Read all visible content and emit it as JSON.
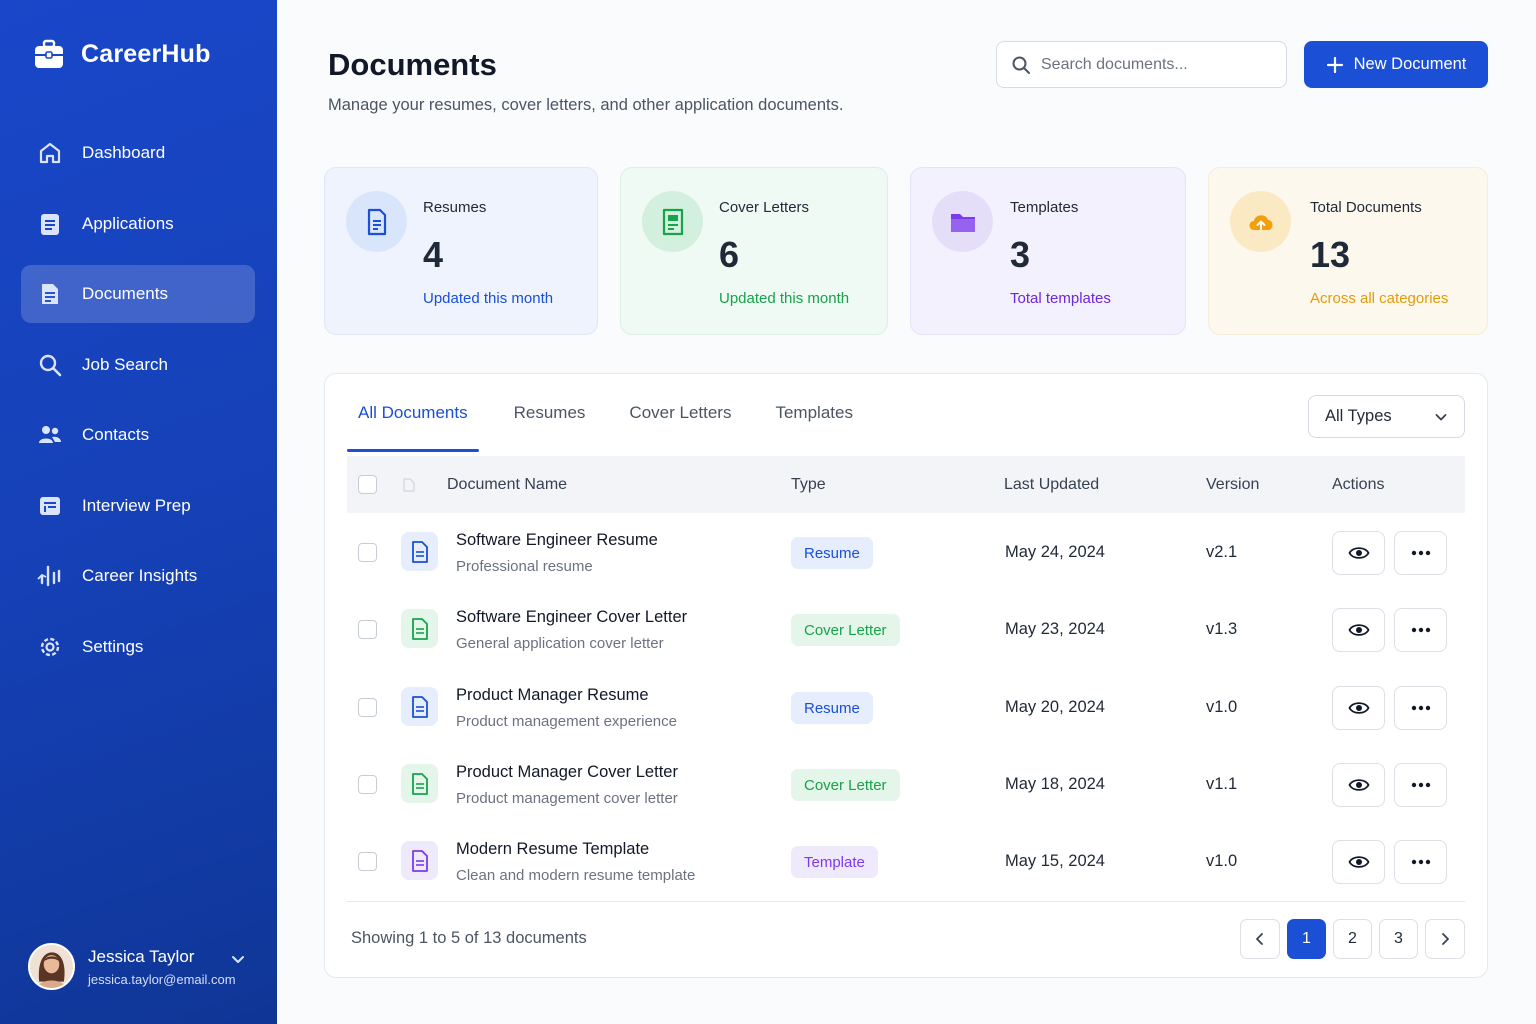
{
  "app": {
    "name": "CareerHub"
  },
  "sidebar": {
    "items": [
      {
        "label": "Dashboard",
        "icon": "home-icon"
      },
      {
        "label": "Applications",
        "icon": "clipboard-icon"
      },
      {
        "label": "Documents",
        "icon": "document-icon",
        "active": true
      },
      {
        "label": "Job Search",
        "icon": "search-icon"
      },
      {
        "label": "Contacts",
        "icon": "users-icon"
      },
      {
        "label": "Interview Prep",
        "icon": "calendar-board-icon"
      },
      {
        "label": "Career Insights",
        "icon": "insights-icon"
      },
      {
        "label": "Settings",
        "icon": "gear-icon"
      }
    ],
    "user": {
      "name": "Jessica Taylor",
      "email": "jessica.taylor@email.com"
    }
  },
  "header": {
    "title": "Documents",
    "subtitle": "Manage your resumes, cover letters, and other application documents.",
    "search_placeholder": "Search documents...",
    "new_button": "New Document"
  },
  "stats": [
    {
      "label": "Resumes",
      "value": "4",
      "note": "Updated this month",
      "color": "#1a4fd6"
    },
    {
      "label": "Cover Letters",
      "value": "6",
      "note": "Updated this month",
      "color": "#16a34a"
    },
    {
      "label": "Templates",
      "value": "3",
      "note": "Total templates",
      "color": "#7c3aed"
    },
    {
      "label": "Total Documents",
      "value": "13",
      "note": "Across all categories",
      "color": "#f59e0b"
    }
  ],
  "tabs": [
    "All Documents",
    "Resumes",
    "Cover Letters",
    "Templates"
  ],
  "filter": {
    "selected": "All Types"
  },
  "table": {
    "columns": [
      "Document Name",
      "Type",
      "Last Updated",
      "Version",
      "Actions"
    ],
    "rows": [
      {
        "name": "Software Engineer Resume",
        "desc": "Professional resume",
        "type": "Resume",
        "updated": "May 24, 2024",
        "version": "v2.1"
      },
      {
        "name": "Software Engineer Cover Letter",
        "desc": "General application cover letter",
        "type": "Cover Letter",
        "updated": "May 23, 2024",
        "version": "v1.3"
      },
      {
        "name": "Product Manager Resume",
        "desc": "Product management experience",
        "type": "Resume",
        "updated": "May 20, 2024",
        "version": "v1.0"
      },
      {
        "name": "Product Manager Cover Letter",
        "desc": "Product management cover letter",
        "type": "Cover Letter",
        "updated": "May 18, 2024",
        "version": "v1.1"
      },
      {
        "name": "Modern Resume Template",
        "desc": "Clean and modern resume template",
        "type": "Template",
        "updated": "May 15, 2024",
        "version": "v1.0"
      }
    ]
  },
  "pagination": {
    "summary": "Showing 1 to 5 of 13 documents",
    "pages": [
      "1",
      "2",
      "3"
    ],
    "current": "1"
  },
  "colors": {
    "primary": "#1a4fd6",
    "resume": "#1a4fd6",
    "cover_letter": "#16a34a",
    "template": "#7c3aed",
    "total": "#f59e0b"
  }
}
